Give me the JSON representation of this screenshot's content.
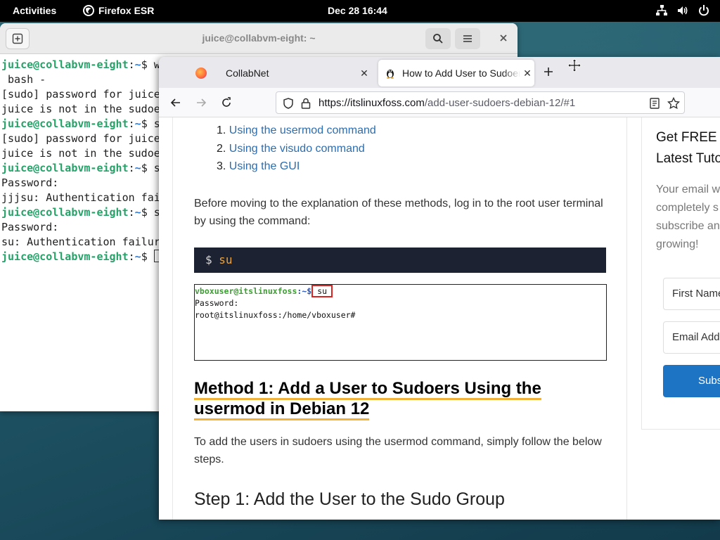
{
  "topbar": {
    "activities": "Activities",
    "app_name": "Firefox ESR",
    "clock": "Dec 28  16:44"
  },
  "terminal": {
    "title": "juice@collabvm-eight: ~",
    "lines": [
      {
        "prompt": "juice@collabvm-eight",
        "path": "~",
        "text": "$ w"
      },
      {
        "text": " bash -"
      },
      {
        "text": "[sudo] password for juice"
      },
      {
        "text": "juice is not in the sudoe"
      },
      {
        "prompt": "juice@collabvm-eight",
        "path": "~",
        "text": "$ s"
      },
      {
        "text": "[sudo] password for juice"
      },
      {
        "text": "juice is not in the sudoe"
      },
      {
        "prompt": "juice@collabvm-eight",
        "path": "~",
        "text": "$ s"
      },
      {
        "text": "Password:"
      },
      {
        "text": "jjjsu: Authentication fai"
      },
      {
        "prompt": "juice@collabvm-eight",
        "path": "~",
        "text": "$ s"
      },
      {
        "text": "Password:"
      },
      {
        "text": "su: Authentication failur"
      },
      {
        "prompt": "juice@collabvm-eight",
        "path": "~",
        "text": "$ ",
        "cursor": true
      }
    ]
  },
  "browser": {
    "tabs": [
      {
        "label": "CollabNet",
        "active": false
      },
      {
        "label": "How to Add User to Sudoers",
        "active": true
      }
    ],
    "url_domain": "https://itslinuxfoss.com",
    "url_path": "/add-user-sudoers-debian-12/#1"
  },
  "article": {
    "toc": [
      {
        "num": "1.",
        "label": "Using the usermod command"
      },
      {
        "num": "2.",
        "label": "Using the visudo command"
      },
      {
        "num": "3.",
        "label": "Using the GUI"
      }
    ],
    "intro": "Before moving to the explanation of these methods, log in to the root user terminal by using the command:",
    "code_prompt": "$",
    "code_cmd": "su",
    "shot_user": "vboxuser@itslinuxfoss",
    "shot_path": ":~$",
    "shot_cmd": "su",
    "shot_line2": "Password:",
    "shot_line3": "root@itslinuxfoss:/home/vboxuser#",
    "method_heading_1": "Method 1: Add a User to Sudoers Using the",
    "method_heading_2": "usermod in Debian 12",
    "method_text": "To add the users in sudoers using the usermod command, simply follow the below steps.",
    "step_heading": "Step 1: Add the User to the Sudo Group"
  },
  "sidebar": {
    "title_1": "Get FREE U",
    "title_2": "Latest Tuto",
    "desc_lines": [
      "Your email w",
      "completely s",
      "subscribe an",
      "growing!"
    ],
    "first_name_placeholder": "First Name",
    "email_placeholder": "Email Addr",
    "subscribe_label": "Subs"
  }
}
